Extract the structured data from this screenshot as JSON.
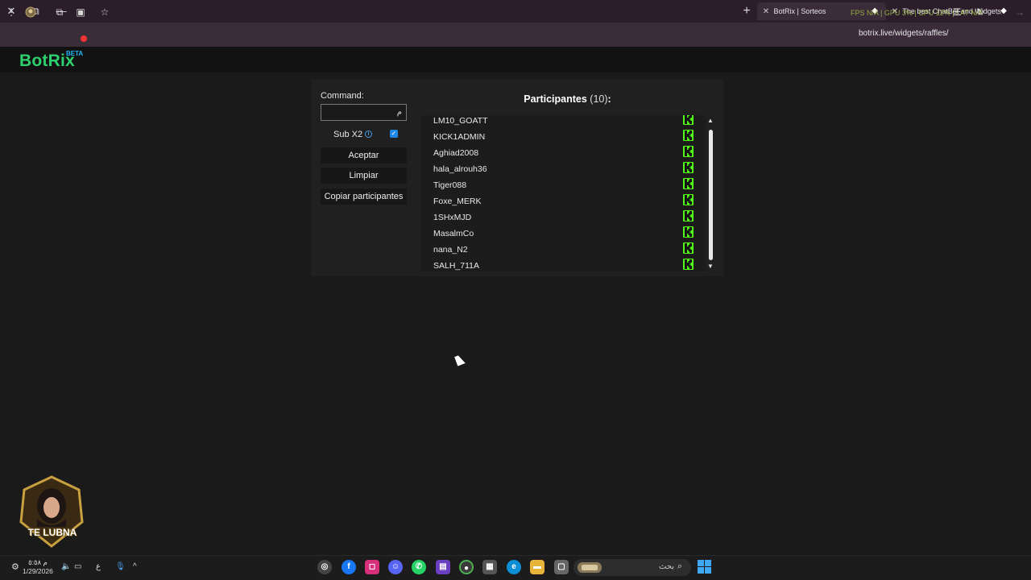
{
  "browser": {
    "tabs": [
      {
        "title": "BotRix | Sorteos",
        "active": true
      },
      {
        "title": "The best ChatBot and Widgets",
        "active": false
      }
    ],
    "overlay_stats": "FPS N/A | GPU 3% | CPU 12% | LAT N/A",
    "url": "botrix.live/widgets/raffles/",
    "window_close": "✕",
    "window_restore": "⧉",
    "window_minimize": "—",
    "new_tab": "+"
  },
  "site": {
    "logo": "BotRix",
    "beta": "BETA"
  },
  "raffle": {
    "command_label": "Command:",
    "command_value": "م",
    "sub_label": "Sub X2",
    "sub_checked": true,
    "accept_button": "Aceptar",
    "clear_button": "Limpiar",
    "copy_button": "Copiar participantes",
    "participants_label": "Participantes",
    "participants_count": "(10)",
    "participants_colon": ":",
    "participants": [
      "LM10_GOATT",
      "KICK1ADMIN",
      "Aghiad2008",
      "hala_alrouh36",
      "Tiger088",
      "Foxe_MERK",
      "1SHxMJD",
      "MasalmCo",
      "nana_N2",
      "SALH_711A"
    ],
    "platform_icon": "kick-icon",
    "platform_color": "#53fc18"
  },
  "overlay": {
    "badge_text": "TE LUBNA"
  },
  "taskbar": {
    "time": "م ٥:٥٨",
    "date": "1/29/2026",
    "language": "ع",
    "search_placeholder": "بحث",
    "apps": [
      "chrome-icon",
      "facebook-icon",
      "instagram-icon",
      "discord-icon",
      "whatsapp-icon",
      "clapper-icon",
      "chrome-icon",
      "store-icon",
      "edge-icon",
      "file-explorer-icon",
      "app-icon"
    ]
  }
}
